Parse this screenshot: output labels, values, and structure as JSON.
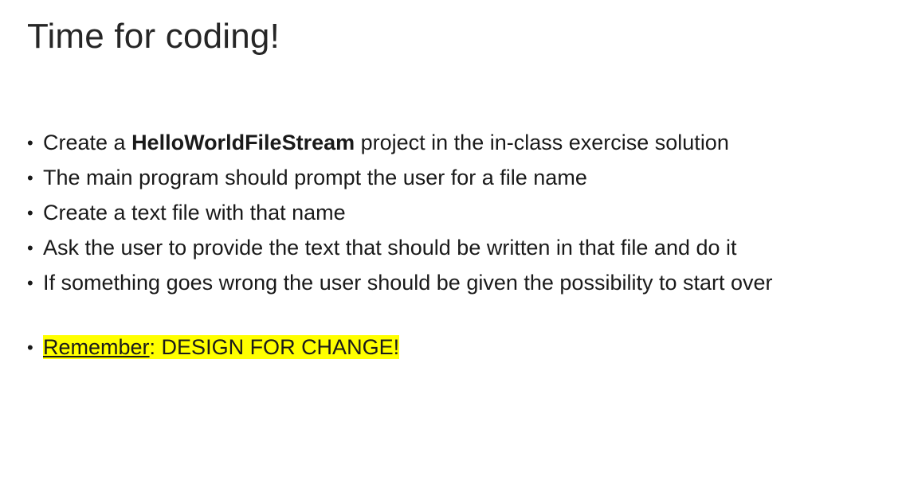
{
  "slide": {
    "title": "Time for coding!",
    "bullets": [
      {
        "pre": "Create a ",
        "bold": "HelloWorldFileStream",
        "post": " project in the in-class exercise solution"
      },
      {
        "text": "The main program should prompt the user for a file name"
      },
      {
        "text": "Create a text file with that name"
      },
      {
        "text": "Ask the user to provide the text that should be written in that file and do it"
      },
      {
        "text": "If something goes wrong the user should be given the possibility to start over"
      },
      {
        "underlined": "Remember",
        "rest": ": DESIGN FOR CHANGE!",
        "highlight_color": "#ffff00"
      }
    ],
    "bullet_glyph": "•"
  }
}
